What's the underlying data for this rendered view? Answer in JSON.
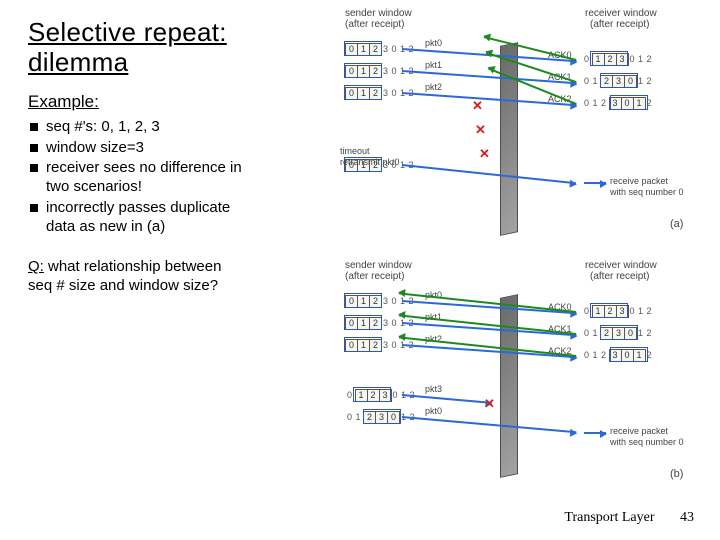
{
  "title_line1": "Selective repeat:",
  "title_line2": " dilemma",
  "example_label": "Example:",
  "bullets": [
    "seq #'s: 0, 1, 2, 3",
    "window size=3",
    "receiver sees no difference in two scenarios!",
    "incorrectly passes duplicate data as new in (a)"
  ],
  "question_label": "Q:",
  "question_text": " what relationship between seq # size and window size?",
  "footer_text": "Transport Layer",
  "page_number": "43",
  "diagram": {
    "sender_window_label": "sender window",
    "after_receipt_label": "(after receipt)",
    "receiver_window_label": "receiver window",
    "pkt_labels": [
      "pkt0",
      "pkt1",
      "pkt2",
      "pkt3"
    ],
    "ack_labels": [
      "ACK0",
      "ACK1",
      "ACK2"
    ],
    "timeout_label1": "timeout",
    "timeout_label2": "retransmit pkt0",
    "receive_label1": "receive packet",
    "receive_label2": "with seq number 0",
    "fig_a": "(a)",
    "fig_b": "(b)",
    "seq_sender_a": [
      {
        "seq": [
          "0",
          "1",
          "2"
        ],
        "after": "3 0 1 2",
        "winStart": 0
      },
      {
        "seq": [
          "0",
          "1",
          "2"
        ],
        "after": "3 0 1 2",
        "winStart": 0
      },
      {
        "seq": [
          "0",
          "1",
          "2"
        ],
        "after": "3 0 1 2",
        "winStart": 0
      },
      {
        "seq": [
          "0",
          "1",
          "2"
        ],
        "after": "3 0 1 2",
        "winStart": 0
      }
    ],
    "seq_receiver_a": [
      {
        "pre": "0",
        "seq": [
          "1",
          "2",
          "3"
        ],
        "after": "0 1 2"
      },
      {
        "pre": "0 1",
        "seq": [
          "2",
          "3",
          "0"
        ],
        "after": "1 2"
      },
      {
        "pre": "0 1 2",
        "seq": [
          "3",
          "0",
          "1"
        ],
        "after": "2"
      }
    ],
    "seq_sender_b": [
      {
        "seq": [
          "0",
          "1",
          "2"
        ],
        "after": "3 0 1 2",
        "winStart": 0
      },
      {
        "seq": [
          "0",
          "1",
          "2"
        ],
        "after": "3 0 1 2",
        "winStart": 0
      },
      {
        "seq": [
          "0",
          "1",
          "2"
        ],
        "after": "3 0 1 2",
        "winStart": 0
      },
      {
        "pre": "0",
        "seq": [
          "1",
          "2",
          "3"
        ],
        "after": "0 1 2"
      },
      {
        "pre": "0 1",
        "seq": [
          "2",
          "3",
          "0"
        ],
        "after": "1 2"
      }
    ],
    "seq_receiver_b": [
      {
        "pre": "0",
        "seq": [
          "1",
          "2",
          "3"
        ],
        "after": "0 1 2"
      },
      {
        "pre": "0 1",
        "seq": [
          "2",
          "3",
          "0"
        ],
        "after": "1 2"
      },
      {
        "pre": "0 1 2",
        "seq": [
          "3",
          "0",
          "1"
        ],
        "after": "2"
      }
    ]
  }
}
